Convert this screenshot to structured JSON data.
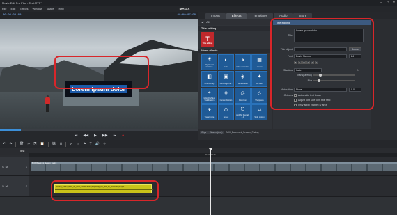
{
  "window": {
    "title": "Movie Edit Pro Plus - Test.MVP*",
    "controls": [
      "–",
      "□",
      "✕"
    ]
  },
  "menu": {
    "items": [
      "File",
      "Edit",
      "Effects",
      "Window",
      "Share",
      "Help"
    ],
    "logo": "MAGIX"
  },
  "preview": {
    "timecode_left": "00:00:00:00",
    "timecode_right": "00:00:07:00",
    "title_text": "Lorem ipsum dolor",
    "transport": [
      "⏮",
      "◀◀",
      "▶",
      "▶▶",
      "⏭",
      "●"
    ]
  },
  "tabs": [
    {
      "label": "Import",
      "active": false
    },
    {
      "label": "Effects",
      "active": true
    },
    {
      "label": "Templates",
      "active": false
    },
    {
      "label": "Audio",
      "active": false
    },
    {
      "label": "Store",
      "active": false
    }
  ],
  "category": {
    "selected": "All",
    "title_section": "Title editing",
    "title_tile_label": "Title editing",
    "video_section": "Video effects",
    "effects": [
      {
        "label": "Brightness/ Contrast",
        "icon": "☀"
      },
      {
        "label": "Color",
        "icon": "◐"
      },
      {
        "label": "Color correction",
        "icon": "◑"
      },
      {
        "label": "Levelizer",
        "icon": "▦"
      },
      {
        "label": "Chroma key",
        "icon": "◧"
      },
      {
        "label": "Windowgame...",
        "icon": "▣"
      },
      {
        "label": "Blendmodes",
        "icon": "◈"
      },
      {
        "label": "Art filter",
        "icon": "✦"
      },
      {
        "label": "MAGIX Video Stabilization",
        "icon": "⌖"
      },
      {
        "label": "Camera/Motion",
        "icon": "✥"
      },
      {
        "label": "Distortion",
        "icon": "◎"
      },
      {
        "label": "Sharpness",
        "icon": "◇"
      },
      {
        "label": "Travel route",
        "icon": "✈"
      },
      {
        "label": "Speed",
        "icon": "⏲"
      },
      {
        "label": "proDAD Mercalli 4.0",
        "icon": "⎋"
      },
      {
        "label": "Slide motion",
        "icon": "⇄"
      }
    ]
  },
  "properties": {
    "header": "Title editing",
    "title_label": "Title",
    "title_value": "Lorem ipsum dolor",
    "title_object_label": "Title object",
    "title_object_btn": "Delete",
    "font_label": "Font",
    "font_value": "David Narrow",
    "font_size": "24",
    "format_buttons": [
      "B",
      "I",
      "U",
      "≡",
      "≡",
      "≡"
    ],
    "shadow_label": "Shadow",
    "shadow_value": "Italic",
    "transparency_label": "Transparency",
    "transparency_value": 0.15,
    "blur_label": "Blur",
    "blur_value": 0.1,
    "animation_label": "Animation",
    "animation_value": "None",
    "animation_num": "0.0",
    "options_label": "Options",
    "options": [
      {
        "label": "Automatic text break",
        "checked": true
      },
      {
        "label": "Adjust font size to fit title field",
        "checked": false
      },
      {
        "label": "Only apply visible TV area",
        "checked": true
      }
    ]
  },
  "files": {
    "tabs": [
      "Clips",
      "Waves (disc)",
      "BOX_Basement_Season_Fading"
    ]
  },
  "timeline": {
    "project_label": "Test",
    "ruler_mark": "00:00:14:12",
    "track1_num": "1",
    "track2_num": "2",
    "track_letters": [
      "S",
      "M"
    ],
    "video_clip_name": "BOX_Basement_Season_Fading",
    "title_clip_name": "Lorem_ipsum_dolor_sit_amet_consectetur_adipiscing_elit_sed_do_eiusmod_tempor"
  }
}
